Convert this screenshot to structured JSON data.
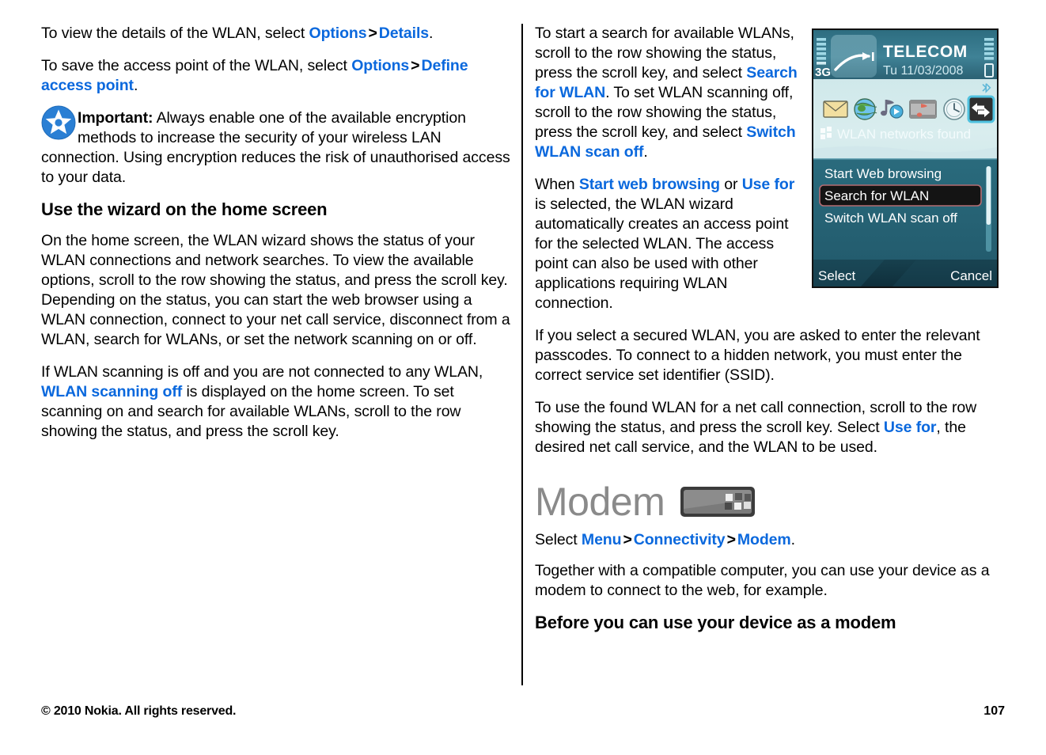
{
  "document": {
    "page_number": "107",
    "copyright": "© 2010 Nokia. All rights reserved.",
    "link_color": "#0a68dd",
    "heading_gray": "#8a8a8a"
  },
  "left_column": {
    "para_details": {
      "p1": "To view the details of the WLAN, select ",
      "link1": "Options",
      "sep1": ">",
      "link2": "Details",
      "p2": "."
    },
    "para_save": {
      "p1": "To save the access point of the WLAN, select ",
      "link1": "Options",
      "sep1": ">",
      "link2": "Define access point",
      "p2": "."
    },
    "important_note": {
      "icon": "important-star-icon",
      "label": "Important:",
      "text": " Always enable one of the available encryption methods to increase the security of your wireless LAN connection. Using encryption reduces the risk of unauthorised access to your data."
    },
    "heading_wizard": "Use the wizard on the home screen",
    "para_homescreen": "On the home screen, the WLAN wizard shows the status of your WLAN connections and network searches. To view the available options, scroll to the row showing the status, and press the scroll key. Depending on the status, you can start the web browser using a WLAN connection, connect to your net call service, disconnect from a WLAN, search for WLANs, or set the network scanning on or off.",
    "para_scanning": {
      "p1": "If WLAN scanning is off and you are not connected to any WLAN, ",
      "link1": "WLAN scanning off",
      "p2": " is displayed on the home screen. To set scanning on and search for available WLANs, scroll to the row showing the status, and press the scroll key."
    }
  },
  "right_column": {
    "para_search": {
      "p1": "To start a search for available WLANs, scroll to the row showing the status, press the scroll key, and select ",
      "link1": "Search for WLAN",
      "p2": ". To set WLAN scanning off, scroll to the row showing the status, press the scroll key, and select ",
      "link2": "Switch WLAN scan off",
      "p3": "."
    },
    "para_wizard": {
      "p1": "When ",
      "link1": "Start web browsing",
      "p2": " or ",
      "link2": "Use for",
      "p3": " is selected, the WLAN wizard automatically creates an access point for the selected WLAN. The access point can also be used with other applications requiring WLAN connection."
    },
    "para_secured": "If you select a secured WLAN, you are asked to enter the relevant passcodes. To connect to a hidden network, you must enter the correct service set identifier (SSID).",
    "para_netcall": {
      "p1": "To use the found WLAN for a net call connection, scroll to the row showing the status, and press the scroll key. Select ",
      "link1": "Use for",
      "p2": ", the desired net call service, and the WLAN to be used."
    },
    "modem_section": {
      "heading": "Modem",
      "icon": "modem-device-icon",
      "select_path": {
        "p1": "Select ",
        "link1": "Menu",
        "sep1": ">",
        "link2": "Connectivity",
        "sep2": ">",
        "link3": "Modem",
        "p2": "."
      },
      "para_together": "Together with a compatible computer, you can use your device as a modem to connect to the web, for example.",
      "heading_before": "Before you can use your device as a modem"
    }
  },
  "phone_screenshot": {
    "status_bar": {
      "network_label": "3G",
      "operator": "TELECOM",
      "date": "Tu 11/03/2008",
      "signal_icon": "signal-strength-icon",
      "battery_icon": "battery-icon",
      "bluetooth_icon": "bluetooth-icon"
    },
    "shortcut_icons": [
      "messaging-envelope-icon",
      "web-globe-icon",
      "music-player-icon",
      "video-gallery-icon",
      "clock-icon",
      "connectivity-switch-icon"
    ],
    "status_row": {
      "icon": "wlan-networks-icon",
      "text": "WLAN networks found"
    },
    "menu_items": [
      {
        "label": "Start Web browsing",
        "selected": false
      },
      {
        "label": "Search for WLAN",
        "selected": true
      },
      {
        "label": "Switch WLAN scan off",
        "selected": false
      }
    ],
    "softkeys": {
      "left": "Select",
      "right": "Cancel"
    }
  }
}
